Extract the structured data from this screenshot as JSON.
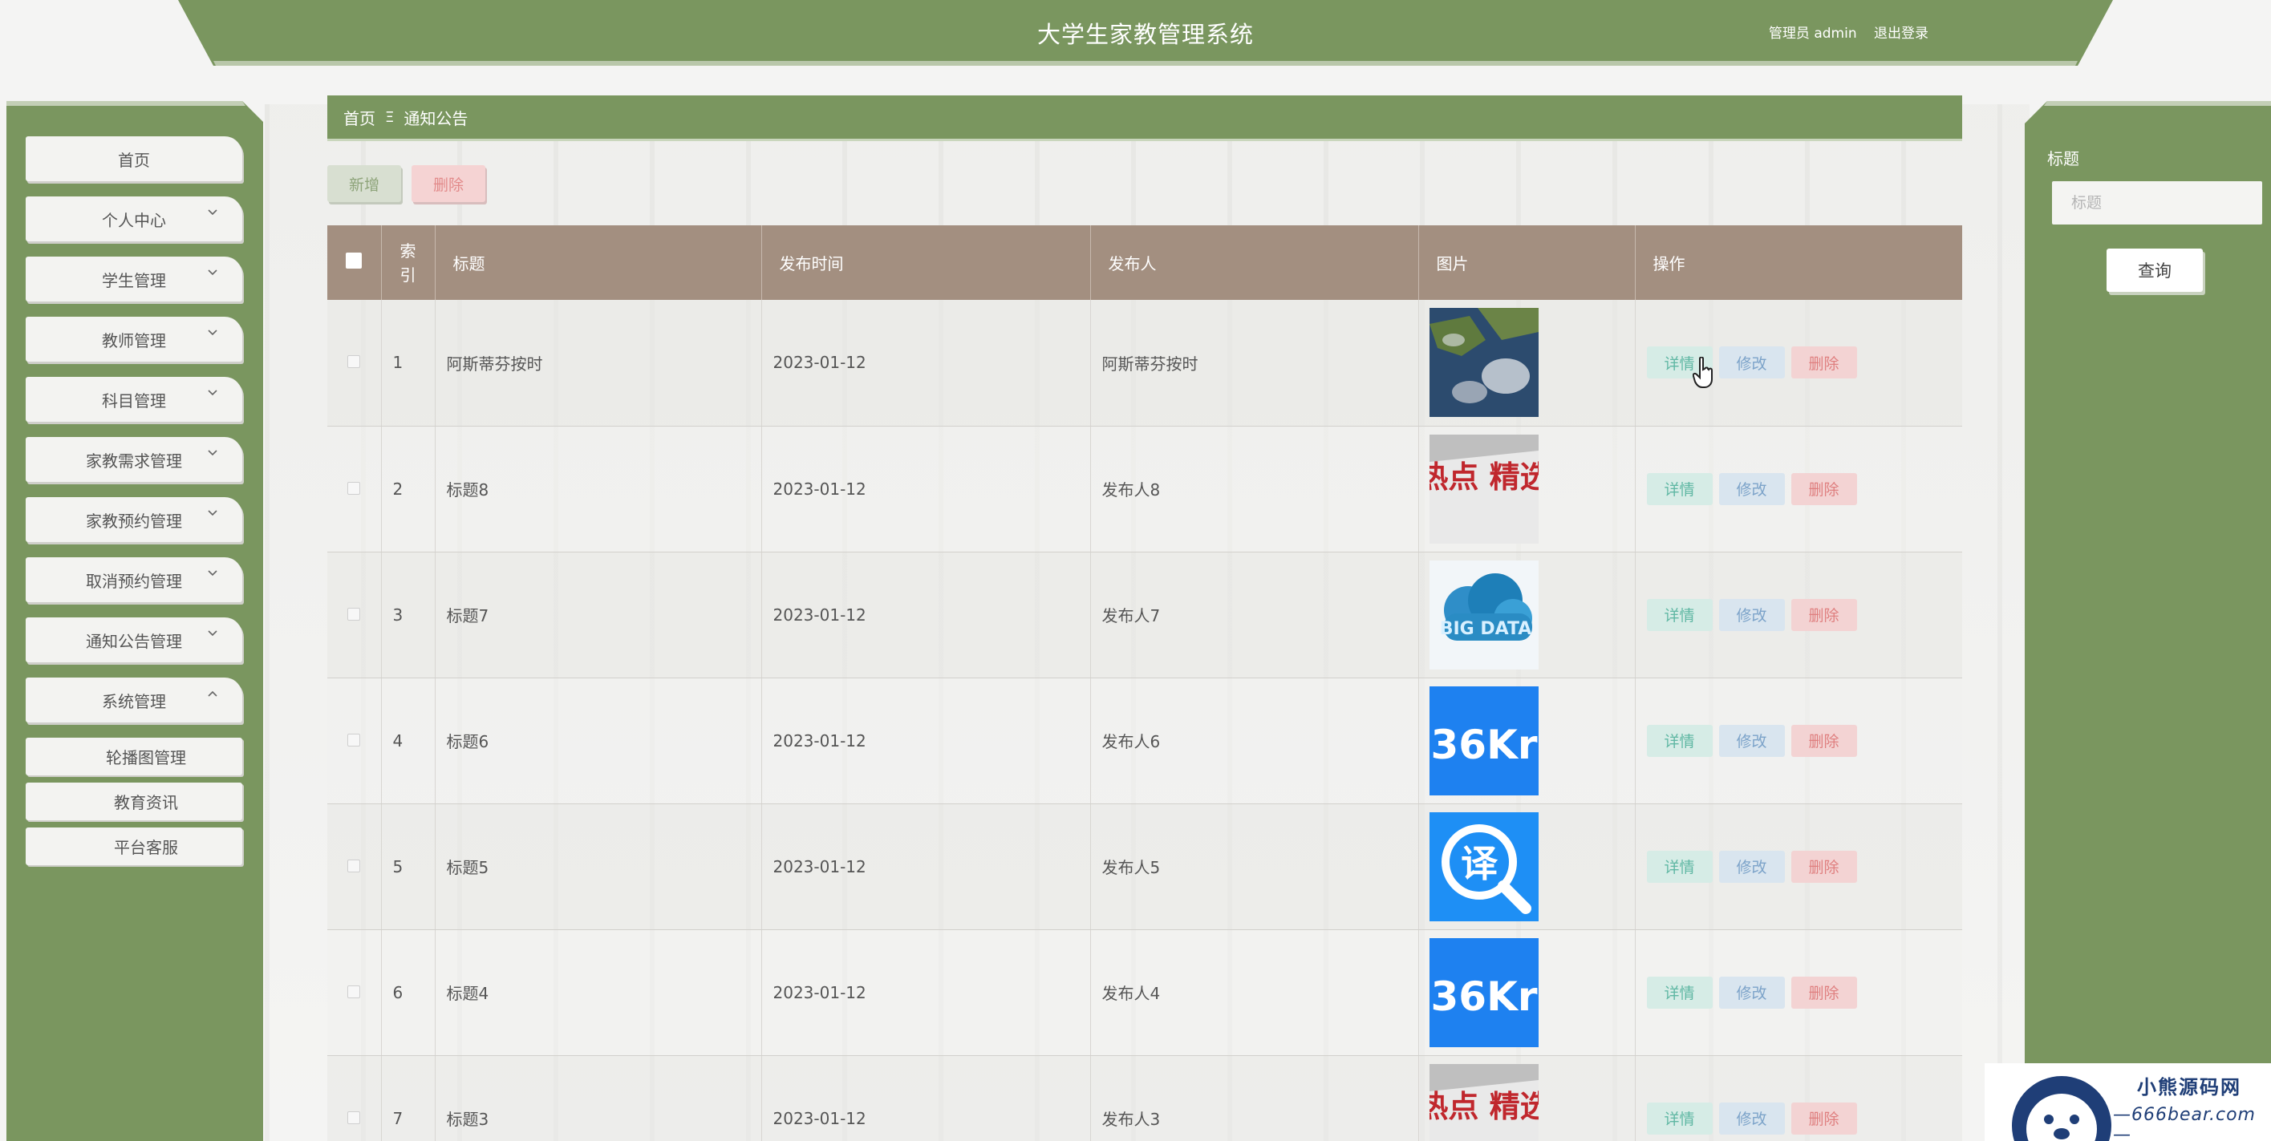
{
  "app": {
    "title": "大学生家教管理系统",
    "user_label": "管理员 admin",
    "logout": "退出登录"
  },
  "sidebar": {
    "items": [
      {
        "label": "首页",
        "has_chevron": false
      },
      {
        "label": "个人中心",
        "has_chevron": true
      },
      {
        "label": "学生管理",
        "has_chevron": true
      },
      {
        "label": "教师管理",
        "has_chevron": true
      },
      {
        "label": "科目管理",
        "has_chevron": true
      },
      {
        "label": "家教需求管理",
        "has_chevron": true
      },
      {
        "label": "家教预约管理",
        "has_chevron": true
      },
      {
        "label": "取消预约管理",
        "has_chevron": true
      },
      {
        "label": "通知公告管理",
        "has_chevron": true
      },
      {
        "label": "系统管理",
        "has_chevron": true,
        "expanded": true
      }
    ],
    "subitems": [
      {
        "label": "轮播图管理"
      },
      {
        "label": "教育资讯"
      },
      {
        "label": "平台客服"
      }
    ]
  },
  "breadcrumb": {
    "home": "首页",
    "separator": "Ξ",
    "current": "通知公告"
  },
  "actions": {
    "add": "新增",
    "delete": "删除"
  },
  "table": {
    "headers": {
      "index": "索引",
      "title": "标题",
      "time": "发布时间",
      "author": "发布人",
      "image": "图片",
      "ops": "操作"
    },
    "rows": [
      {
        "index": "1",
        "title": "阿斯蒂芬按时",
        "time": "2023-01-12",
        "author": "阿斯蒂芬按时",
        "image": "satellite-map"
      },
      {
        "index": "2",
        "title": "标题8",
        "time": "2023-01-12",
        "author": "发布人8",
        "image": "hot-picks",
        "image_text": "热点 精选"
      },
      {
        "index": "3",
        "title": "标题7",
        "time": "2023-01-12",
        "author": "发布人7",
        "image": "big-data-cloud",
        "image_text": "BIG DATA"
      },
      {
        "index": "4",
        "title": "标题6",
        "time": "2023-01-12",
        "author": "发布人6",
        "image": "36kr",
        "image_text": "36Kr"
      },
      {
        "index": "5",
        "title": "标题5",
        "time": "2023-01-12",
        "author": "发布人5",
        "image": "translate",
        "image_text": "译"
      },
      {
        "index": "6",
        "title": "标题4",
        "time": "2023-01-12",
        "author": "发布人4",
        "image": "36kr",
        "image_text": "36Kr"
      },
      {
        "index": "7",
        "title": "标题3",
        "time": "2023-01-12",
        "author": "发布人3",
        "image": "hot-picks",
        "image_text": "热点 精选"
      }
    ],
    "op_labels": {
      "detail": "详情",
      "edit": "修改",
      "delete": "删除"
    }
  },
  "search": {
    "label": "标题",
    "placeholder": "标题",
    "value": "",
    "button": "查询"
  },
  "watermark": {
    "line1": "小熊源码网",
    "line2": "—666bear.com—"
  },
  "colors": {
    "primary_green": "#7a965f",
    "table_header": "#a38f80",
    "detail": "#5fb7a3",
    "edit": "#7ca3c9",
    "danger": "#df7f7f"
  }
}
